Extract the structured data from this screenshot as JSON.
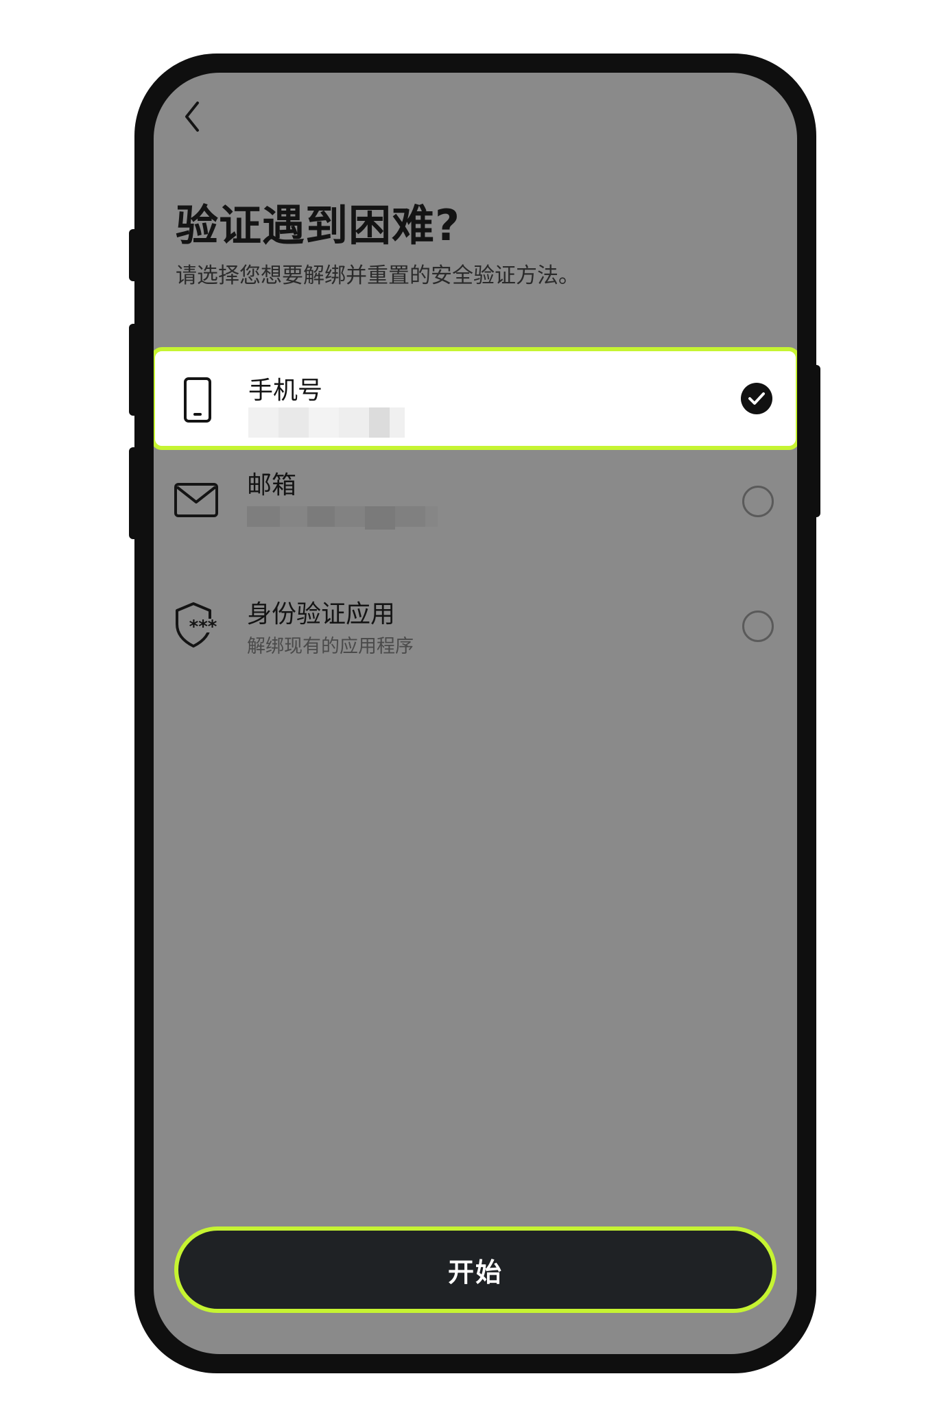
{
  "header": {
    "title": "验证遇到困难?",
    "subtitle": "请选择您想要解绑并重置的安全验证方法。"
  },
  "options": [
    {
      "label": "手机号",
      "detail": "",
      "icon": "phone-icon",
      "selected": true
    },
    {
      "label": "邮箱",
      "detail": "",
      "icon": "mail-icon",
      "selected": false
    },
    {
      "label": "身份验证应用",
      "detail": "解绑现有的应用程序",
      "icon": "shield-icon",
      "selected": false
    }
  ],
  "footer": {
    "start_label": "开始"
  },
  "colors": {
    "accent": "#c6f432",
    "screen_overlay": "#8a8a8a",
    "button_bg": "#1f2225"
  }
}
